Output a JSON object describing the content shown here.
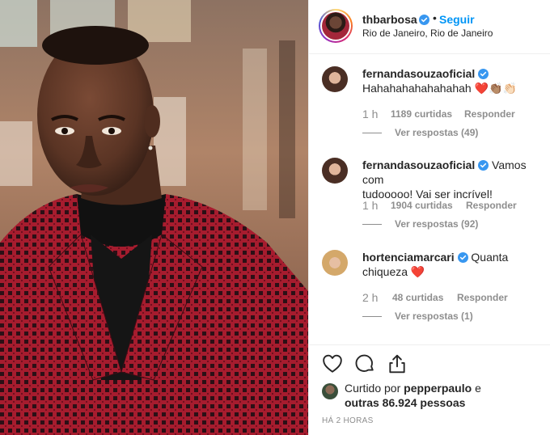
{
  "post": {
    "username": "thbarbosa",
    "separator": "•",
    "follow_label": "Seguir",
    "location": "Rio de Janeiro, Rio de Janeiro"
  },
  "comments": [
    {
      "username": "fernandasouzaoficial",
      "text_line1": "Hahahahahahahahah ❤️👏🏽👏🏻",
      "text_line2": "",
      "time": "1 h",
      "likes": "1189 curtidas",
      "reply_label": "Responder",
      "view_replies": "Ver respostas (49)"
    },
    {
      "username": "fernandasouzaoficial",
      "text_line1": "Vamos com",
      "text_line2": "tudooooo! Vai ser incrível!",
      "time": "1 h",
      "likes": "1904 curtidas",
      "reply_label": "Responder",
      "view_replies": "Ver respostas (92)"
    },
    {
      "username": "hortenciamarcari",
      "text_line1": "Quanta",
      "text_line2": "chiqueza ❤️",
      "time": "2 h",
      "likes": "48 curtidas",
      "reply_label": "Responder",
      "view_replies": "Ver respostas (1)"
    }
  ],
  "likes": {
    "prefix": "Curtido por",
    "first_user": "pepperpaulo",
    "connector": "e",
    "others": "outras 86.924 pessoas"
  },
  "time_ago": "HÁ 2 HORAS",
  "icons": {
    "verified": "verified-badge-icon",
    "like": "heart-icon",
    "comment": "comment-bubble-icon",
    "share": "share-icon"
  },
  "colors": {
    "verified_blue": "#3897f0",
    "follow_blue": "#0095f6",
    "muted": "#8e8e8e",
    "text": "#262626"
  }
}
